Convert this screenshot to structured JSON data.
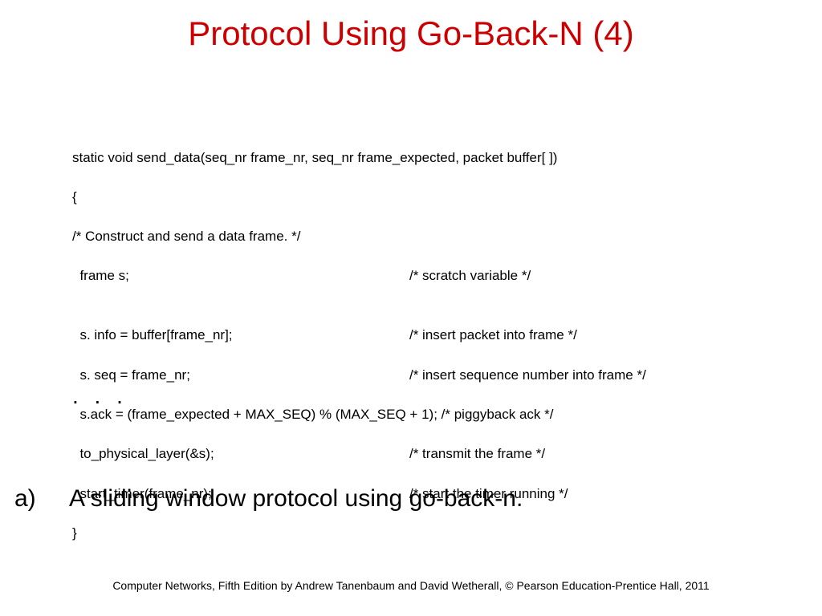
{
  "title": "Protocol Using Go-Back-N (4)",
  "code": {
    "l1": "static void send_data(seq_nr frame_nr, seq_nr frame_expected, packet buffer[ ])",
    "l2": "{",
    "l3": "/* Construct and send a data frame. */",
    "l4l": "  frame s;",
    "l4r": "/* scratch variable */",
    "l5": "",
    "l6l": "  s. info = buffer[frame_nr];",
    "l6r": "/* insert packet into frame */",
    "l7l": "  s. seq = frame_nr;",
    "l7r": "/* insert sequence number into frame */",
    "l8": "  s.ack = (frame_expected + MAX_SEQ) % (MAX_SEQ + 1); /* piggyback ack */",
    "l9l": "  to_physical_layer(&s);",
    "l9r": "/* transmit the frame */",
    "l10l": "  start_timer(frame_nr);",
    "l10r": "/* start the timer running */",
    "l11": "}"
  },
  "ellipsis": ". . .",
  "caption": {
    "label": "a)",
    "text": "A sliding window protocol using go-back-n."
  },
  "footer": "Computer Networks, Fifth Edition by Andrew Tanenbaum and David Wetherall, © Pearson Education-Prentice Hall, 2011"
}
